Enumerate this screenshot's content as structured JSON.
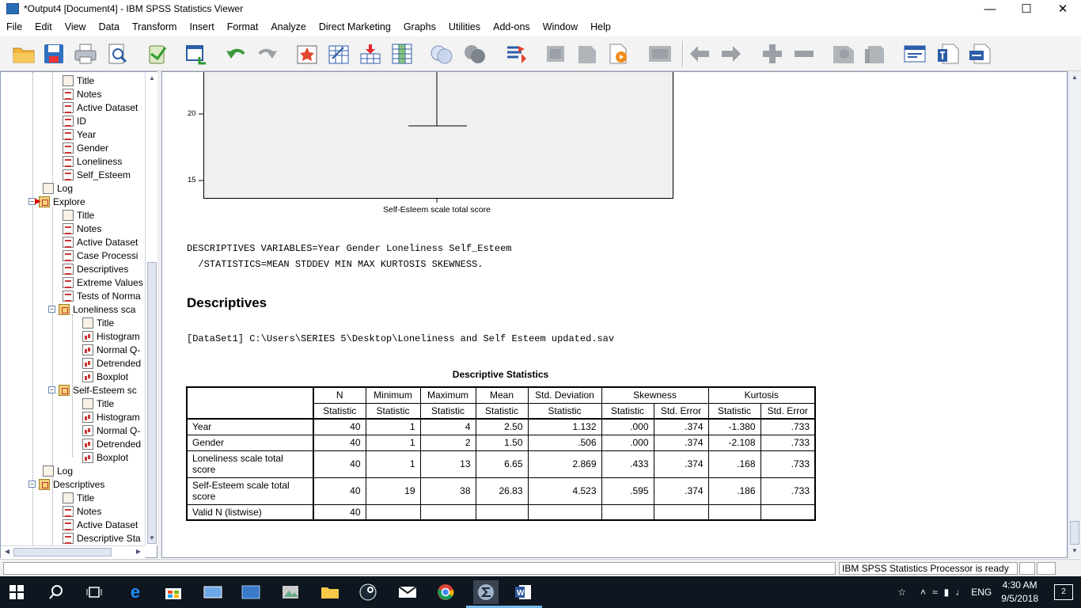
{
  "window": {
    "title": "*Output4 [Document4] - IBM SPSS Statistics Viewer"
  },
  "menu": [
    "File",
    "Edit",
    "View",
    "Data",
    "Transform",
    "Insert",
    "Format",
    "Analyze",
    "Direct Marketing",
    "Graphs",
    "Utilities",
    "Add-ons",
    "Window",
    "Help"
  ],
  "toolbar_icons": [
    "open-folder-icon",
    "save-icon",
    "print-icon",
    "print-preview-icon",
    "export-icon",
    "recall-dialog-icon",
    "undo-icon",
    "redo-icon",
    "go-to-data-icon",
    "go-to-case-icon",
    "go-to-variable-icon",
    "variables-icon",
    "select-cases-icon",
    "weight-cases-icon",
    "value-labels-icon",
    "use-sets-icon",
    "show-all-variables-icon",
    "spelling-icon",
    "run-icon",
    "designate-window-icon",
    "back-icon",
    "forward-icon",
    "expand-icon",
    "collapse-icon",
    "show-icon",
    "hide-icon",
    "insert-heading-icon",
    "insert-title-icon",
    "insert-text-icon"
  ],
  "nav": {
    "items": [
      {
        "label": "Title",
        "icon": "book"
      },
      {
        "label": "Notes",
        "icon": "tbl"
      },
      {
        "label": "Active Dataset",
        "icon": "tbl"
      },
      {
        "label": "ID",
        "icon": "tbl"
      },
      {
        "label": "Year",
        "icon": "tbl"
      },
      {
        "label": "Gender",
        "icon": "tbl"
      },
      {
        "label": "Loneliness",
        "icon": "tbl"
      },
      {
        "label": "Self_Esteem",
        "icon": "tbl"
      },
      {
        "label": "Log",
        "icon": "book"
      },
      {
        "label": "Explore",
        "icon": "grp"
      },
      {
        "label": "Title",
        "icon": "book"
      },
      {
        "label": "Notes",
        "icon": "tbl"
      },
      {
        "label": "Active Dataset",
        "icon": "tbl"
      },
      {
        "label": "Case Processi",
        "icon": "tbl"
      },
      {
        "label": "Descriptives",
        "icon": "tbl"
      },
      {
        "label": "Extreme Values",
        "icon": "tbl"
      },
      {
        "label": "Tests of Norma",
        "icon": "tbl"
      },
      {
        "label": "Loneliness sca",
        "icon": "grp"
      },
      {
        "label": "Title",
        "icon": "book"
      },
      {
        "label": "Histogram",
        "icon": "chart"
      },
      {
        "label": "Normal Q-",
        "icon": "chart"
      },
      {
        "label": "Detrended",
        "icon": "chart"
      },
      {
        "label": "Boxplot",
        "icon": "chart"
      },
      {
        "label": "Self-Esteem sc",
        "icon": "grp"
      },
      {
        "label": "Title",
        "icon": "book"
      },
      {
        "label": "Histogram",
        "icon": "chart"
      },
      {
        "label": "Normal Q-",
        "icon": "chart"
      },
      {
        "label": "Detrended",
        "icon": "chart"
      },
      {
        "label": "Boxplot",
        "icon": "chart"
      },
      {
        "label": "Log",
        "icon": "book"
      },
      {
        "label": "Descriptives",
        "icon": "grp"
      },
      {
        "label": "Title",
        "icon": "book"
      },
      {
        "label": "Notes",
        "icon": "tbl"
      },
      {
        "label": "Active Dataset",
        "icon": "tbl"
      },
      {
        "label": "Descriptive Sta",
        "icon": "tbl"
      }
    ]
  },
  "boxplot": {
    "ticks": [
      "20",
      "15"
    ],
    "xlabel": "Self-Esteem scale total score"
  },
  "syntax": {
    "line1": "DESCRIPTIVES VARIABLES=Year Gender Loneliness Self_Esteem",
    "line2": "  /STATISTICS=MEAN STDDEV MIN MAX KURTOSIS SKEWNESS."
  },
  "section_title": "Descriptives",
  "dataset_line": "[DataSet1] C:\\Users\\SERIES 5\\Desktop\\Loneliness and Self Esteem updated.sav",
  "table": {
    "title": "Descriptive Statistics",
    "header1": [
      "N",
      "Minimum",
      "Maximum",
      "Mean",
      "Std. Deviation",
      "Skewness",
      "Kurtosis"
    ],
    "header2": [
      "Statistic",
      "Statistic",
      "Statistic",
      "Statistic",
      "Statistic",
      "Statistic",
      "Std. Error",
      "Statistic",
      "Std. Error"
    ],
    "rows": [
      {
        "label": "Year",
        "cells": [
          "40",
          "1",
          "4",
          "2.50",
          "1.132",
          ".000",
          ".374",
          "-1.380",
          ".733"
        ]
      },
      {
        "label": "Gender",
        "cells": [
          "40",
          "1",
          "2",
          "1.50",
          ".506",
          ".000",
          ".374",
          "-2.108",
          ".733"
        ]
      },
      {
        "label": "Loneliness scale total score",
        "cells": [
          "40",
          "1",
          "13",
          "6.65",
          "2.869",
          ".433",
          ".374",
          ".168",
          ".733"
        ]
      },
      {
        "label": "Self-Esteem scale total score",
        "cells": [
          "40",
          "19",
          "38",
          "26.83",
          "4.523",
          ".595",
          ".374",
          ".186",
          ".733"
        ]
      },
      {
        "label": "Valid N (listwise)",
        "cells": [
          "40",
          "",
          "",
          "",
          "",
          "",
          "",
          "",
          ""
        ]
      }
    ]
  },
  "status": {
    "processor": "IBM SPSS Statistics Processor is ready"
  },
  "taskbar": {
    "apps": [
      "start-icon",
      "search-icon",
      "task-view-icon",
      "edge-icon",
      "store-icon",
      "app-icon-1",
      "app-icon-2",
      "app-icon-3",
      "file-explorer-icon",
      "steam-icon",
      "mail-icon",
      "chrome-icon",
      "spss-icon",
      "word-icon"
    ],
    "lang": "ENG",
    "time": "4:30 AM",
    "date": "9/5/2018",
    "notifications": "2"
  }
}
